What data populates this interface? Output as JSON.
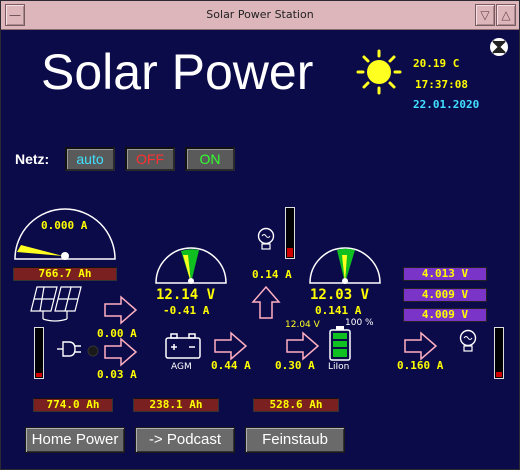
{
  "window": {
    "title": "Solar Power Station"
  },
  "header": {
    "title": "Solar Power",
    "temperature": "20.19 C",
    "time": "17:37:08",
    "date": "22.01.2020"
  },
  "netz": {
    "label": "Netz:",
    "buttons": [
      "auto",
      "OFF",
      "ON"
    ],
    "colors": [
      "#40e0ff",
      "#ff3030",
      "#30ff30"
    ]
  },
  "solar": {
    "current": "0.000 A",
    "ah": "766.7 Ah"
  },
  "lamp1": {
    "current": "0.14 A",
    "level": 0.2
  },
  "gauge_agm": {
    "voltage": "12.14 V",
    "current": "-0.41 A"
  },
  "gauge_liion": {
    "voltage": "12.03 V",
    "current": "0.141 A"
  },
  "cells": [
    "4.013 V",
    "4.009 V",
    "4.009 V"
  ],
  "flows": {
    "solar_in": "0.00 A",
    "grid_in": "0.03 A",
    "agm_out": "0.44 A",
    "to_liion": "0.30 A",
    "load": "0.160 A"
  },
  "liion": {
    "voltage": "12.04 V",
    "percent": "100 %",
    "label": "LiIon"
  },
  "agm": {
    "label": "AGM"
  },
  "counters": [
    "774.0 Ah",
    "238.1 Ah",
    "528.6 Ah"
  ],
  "left_bar_level": 0.08,
  "right_bar_level": 0.1,
  "bottom_buttons": [
    "Home Power",
    "-> Podcast",
    "Feinstaub"
  ],
  "icons": [
    "sun-icon",
    "close-icon",
    "solar-panel-icon",
    "plug-icon",
    "battery-icon",
    "lightbulb-icon"
  ]
}
